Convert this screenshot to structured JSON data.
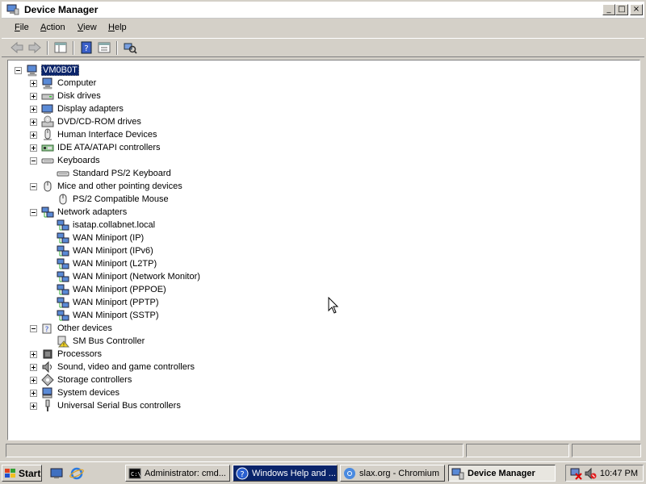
{
  "window": {
    "title": "Device Manager",
    "controls": {
      "minimize": "_",
      "maximize": "□",
      "close": "×"
    }
  },
  "menu": [
    "File",
    "Action",
    "View",
    "Help"
  ],
  "tree": [
    {
      "label": "VM0B0T",
      "depth": 0,
      "state": "expanded",
      "icon": "computer-icon",
      "selected": true
    },
    {
      "label": "Computer",
      "depth": 1,
      "state": "collapsed",
      "icon": "computer-icon"
    },
    {
      "label": "Disk drives",
      "depth": 1,
      "state": "collapsed",
      "icon": "disk-drive-icon"
    },
    {
      "label": "Display adapters",
      "depth": 1,
      "state": "collapsed",
      "icon": "display-adapter-icon"
    },
    {
      "label": "DVD/CD-ROM drives",
      "depth": 1,
      "state": "collapsed",
      "icon": "dvd-drive-icon"
    },
    {
      "label": "Human Interface Devices",
      "depth": 1,
      "state": "collapsed",
      "icon": "hid-icon"
    },
    {
      "label": "IDE ATA/ATAPI controllers",
      "depth": 1,
      "state": "collapsed",
      "icon": "ide-controller-icon"
    },
    {
      "label": "Keyboards",
      "depth": 1,
      "state": "expanded",
      "icon": "keyboard-icon"
    },
    {
      "label": "Standard PS/2 Keyboard",
      "depth": 2,
      "state": "leaf",
      "icon": "keyboard-icon"
    },
    {
      "label": "Mice and other pointing devices",
      "depth": 1,
      "state": "expanded",
      "icon": "mouse-icon"
    },
    {
      "label": "PS/2 Compatible Mouse",
      "depth": 2,
      "state": "leaf",
      "icon": "mouse-icon"
    },
    {
      "label": "Network adapters",
      "depth": 1,
      "state": "expanded",
      "icon": "network-adapter-icon"
    },
    {
      "label": "isatap.collabnet.local",
      "depth": 2,
      "state": "leaf",
      "icon": "network-adapter-icon"
    },
    {
      "label": "WAN Miniport (IP)",
      "depth": 2,
      "state": "leaf",
      "icon": "network-adapter-icon"
    },
    {
      "label": "WAN Miniport (IPv6)",
      "depth": 2,
      "state": "leaf",
      "icon": "network-adapter-icon"
    },
    {
      "label": "WAN Miniport (L2TP)",
      "depth": 2,
      "state": "leaf",
      "icon": "network-adapter-icon"
    },
    {
      "label": "WAN Miniport (Network Monitor)",
      "depth": 2,
      "state": "leaf",
      "icon": "network-adapter-icon"
    },
    {
      "label": "WAN Miniport (PPPOE)",
      "depth": 2,
      "state": "leaf",
      "icon": "network-adapter-icon"
    },
    {
      "label": "WAN Miniport (PPTP)",
      "depth": 2,
      "state": "leaf",
      "icon": "network-adapter-icon"
    },
    {
      "label": "WAN Miniport (SSTP)",
      "depth": 2,
      "state": "leaf",
      "icon": "network-adapter-icon"
    },
    {
      "label": "Other devices",
      "depth": 1,
      "state": "expanded",
      "icon": "unknown-device-icon"
    },
    {
      "label": "SM Bus Controller",
      "depth": 2,
      "state": "leaf",
      "icon": "warning-device-icon"
    },
    {
      "label": "Processors",
      "depth": 1,
      "state": "collapsed",
      "icon": "processor-icon"
    },
    {
      "label": "Sound, video and game controllers",
      "depth": 1,
      "state": "collapsed",
      "icon": "sound-icon"
    },
    {
      "label": "Storage controllers",
      "depth": 1,
      "state": "collapsed",
      "icon": "storage-controller-icon"
    },
    {
      "label": "System devices",
      "depth": 1,
      "state": "collapsed",
      "icon": "system-devices-icon"
    },
    {
      "label": "Universal Serial Bus controllers",
      "depth": 1,
      "state": "collapsed",
      "icon": "usb-icon"
    }
  ],
  "taskbar": {
    "start": "Start",
    "tasks": [
      {
        "label": "Administrator: cmd...",
        "icon": "cmd-icon",
        "state": "normal"
      },
      {
        "label": "Windows Help and ...",
        "icon": "help-icon",
        "state": "highlighted"
      },
      {
        "label": "slax.org - Chromium",
        "icon": "chromium-icon",
        "state": "normal"
      },
      {
        "label": "Device Manager",
        "icon": "device-manager-icon",
        "state": "active"
      }
    ],
    "clock": "10:47 PM"
  },
  "colors": {
    "selection": "#0a246a",
    "chrome": "#d4d0c8"
  }
}
